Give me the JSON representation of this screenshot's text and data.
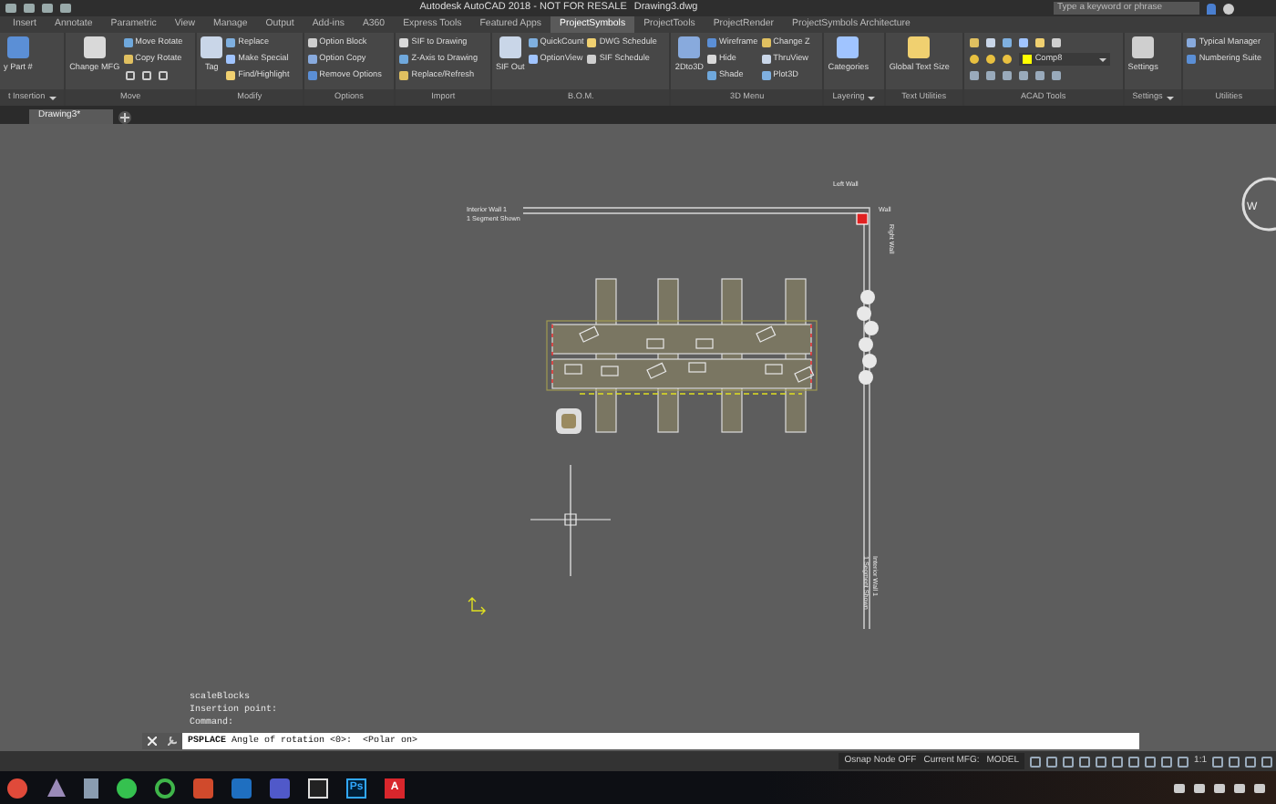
{
  "title_bar": {
    "title": "Autodesk AutoCAD 2018 - NOT FOR RESALE",
    "file": "Drawing3.dwg",
    "search": {
      "placeholder": "Type a keyword or phrase"
    }
  },
  "menu_tabs": [
    {
      "label": "Insert",
      "selected": false
    },
    {
      "label": "Annotate",
      "selected": false
    },
    {
      "label": "Parametric",
      "selected": false
    },
    {
      "label": "View",
      "selected": false
    },
    {
      "label": "Manage",
      "selected": false
    },
    {
      "label": "Output",
      "selected": false
    },
    {
      "label": "Add-ins",
      "selected": false
    },
    {
      "label": "A360",
      "selected": false
    },
    {
      "label": "Express Tools",
      "selected": false
    },
    {
      "label": "Featured Apps",
      "selected": false
    },
    {
      "label": "ProjectSymbols",
      "selected": true
    },
    {
      "label": "ProjectTools",
      "selected": false
    },
    {
      "label": "ProjectRender",
      "selected": false
    },
    {
      "label": "ProjectSymbols Architecture",
      "selected": false
    }
  ],
  "ribbon_panels": [
    {
      "label": "t Insertion",
      "dropdown": true,
      "columns": [
        {
          "kind": "large",
          "label": "y Part #"
        }
      ]
    },
    {
      "label": "Move",
      "columns": [
        {
          "kind": "large",
          "label": "Change MFG"
        },
        {
          "kind": "stack",
          "items": [
            {
              "kind": "text",
              "label": "Move Rotate"
            },
            {
              "kind": "text",
              "label": "Copy Rotate"
            },
            {
              "kind": "icons"
            }
          ]
        }
      ]
    },
    {
      "label": "Modify",
      "columns": [
        {
          "kind": "large",
          "label": "Tag"
        },
        {
          "kind": "stack",
          "items": [
            {
              "kind": "text",
              "label": "Replace"
            },
            {
              "kind": "text",
              "label": "Make Special"
            },
            {
              "kind": "text",
              "label": "Find/Highlight"
            }
          ]
        }
      ]
    },
    {
      "label": "Options",
      "columns": [
        {
          "kind": "stack",
          "items": [
            {
              "kind": "text",
              "label": "Option Block"
            },
            {
              "kind": "text",
              "label": "Option Copy"
            },
            {
              "kind": "text",
              "label": "Remove Options"
            }
          ]
        }
      ]
    },
    {
      "label": "Import",
      "columns": [
        {
          "kind": "stack",
          "items": [
            {
              "kind": "text",
              "label": "SIF to Drawing"
            },
            {
              "kind": "text",
              "label": "Z-Axis to Drawing"
            },
            {
              "kind": "text",
              "label": "Replace/Refresh"
            }
          ]
        }
      ]
    },
    {
      "label": "B.O.M.",
      "columns": [
        {
          "kind": "large",
          "label": "SIF Out"
        },
        {
          "kind": "stack",
          "items": [
            {
              "kind": "text",
              "label": "QuickCount"
            },
            {
              "kind": "text",
              "label": "OptionView"
            }
          ]
        },
        {
          "kind": "stack",
          "items": [
            {
              "kind": "text",
              "label": "DWG Schedule"
            },
            {
              "kind": "text",
              "label": "SIF Schedule"
            }
          ]
        }
      ]
    },
    {
      "label": "3D Menu",
      "columns": [
        {
          "kind": "large",
          "label": "2Dto3D"
        },
        {
          "kind": "stack",
          "items": [
            {
              "kind": "text",
              "label": "Wireframe"
            },
            {
              "kind": "text",
              "label": "Hide"
            },
            {
              "kind": "text",
              "label": "Shade"
            }
          ]
        },
        {
          "kind": "stack",
          "items": [
            {
              "kind": "text",
              "label": "Change Z"
            },
            {
              "kind": "text",
              "label": "ThruView"
            },
            {
              "kind": "text",
              "label": "Plot3D"
            }
          ]
        }
      ]
    },
    {
      "label": "Layering",
      "dropdown": true,
      "columns": [
        {
          "kind": "large",
          "label": "Categories"
        }
      ]
    },
    {
      "label": "Text Utilities",
      "columns": [
        {
          "kind": "large",
          "label": "Global Text Size"
        }
      ]
    },
    {
      "label": "ACAD Tools",
      "columns": [
        {
          "kind": "acad",
          "layer": "Comp8"
        }
      ]
    },
    {
      "label": "Settings",
      "dropdown": true,
      "columns": [
        {
          "kind": "large",
          "label": "Settings"
        }
      ]
    },
    {
      "label": "Utilities",
      "columns": [
        {
          "kind": "stack",
          "items": [
            {
              "kind": "text",
              "label": "Typical Manager"
            },
            {
              "kind": "text",
              "label": "Numbering Suite"
            }
          ]
        }
      ]
    }
  ],
  "doc_tabs": [
    {
      "label": "Drawing3*",
      "selected": true
    }
  ],
  "canvas": {
    "labels": [
      "Interior Wall 1",
      "1 Segment Shown",
      "Left Wall",
      "Wall",
      "Right Wall",
      "Interior Wall 1",
      "1 Segment Shown"
    ],
    "view_cube": "W"
  },
  "command_history": [
    "scaleBlocks",
    "Insertion point:",
    "Command:"
  ],
  "command_line": "**PSPLACE** Angle of rotation <0>:  <Polar on>",
  "status_bar": {
    "texts": [
      "Osnap Node OFF",
      "Current MFG:",
      "MODEL"
    ],
    "scale": "1:1"
  },
  "taskbar": {
    "apps": [
      {
        "kind": "round",
        "color": "#e04a3a"
      },
      {
        "kind": "triangle",
        "color": "#9a8ab8"
      },
      {
        "kind": "doc",
        "color": "#8a9cb0"
      },
      {
        "kind": "round",
        "color": "#35c14f"
      },
      {
        "kind": "ring",
        "color": "#3fb54a"
      },
      {
        "kind": "tile",
        "color": "#d04a2c"
      },
      {
        "kind": "tile",
        "color": "#1f6fc0"
      },
      {
        "kind": "tile",
        "color": "#5059c9"
      },
      {
        "kind": "photo",
        "color": "#dddddd"
      },
      {
        "kind": "letter",
        "color": "#31a8ff",
        "glyph": "Ps"
      },
      {
        "kind": "letter",
        "color": "#d8262c",
        "glyph": "A"
      }
    ]
  }
}
